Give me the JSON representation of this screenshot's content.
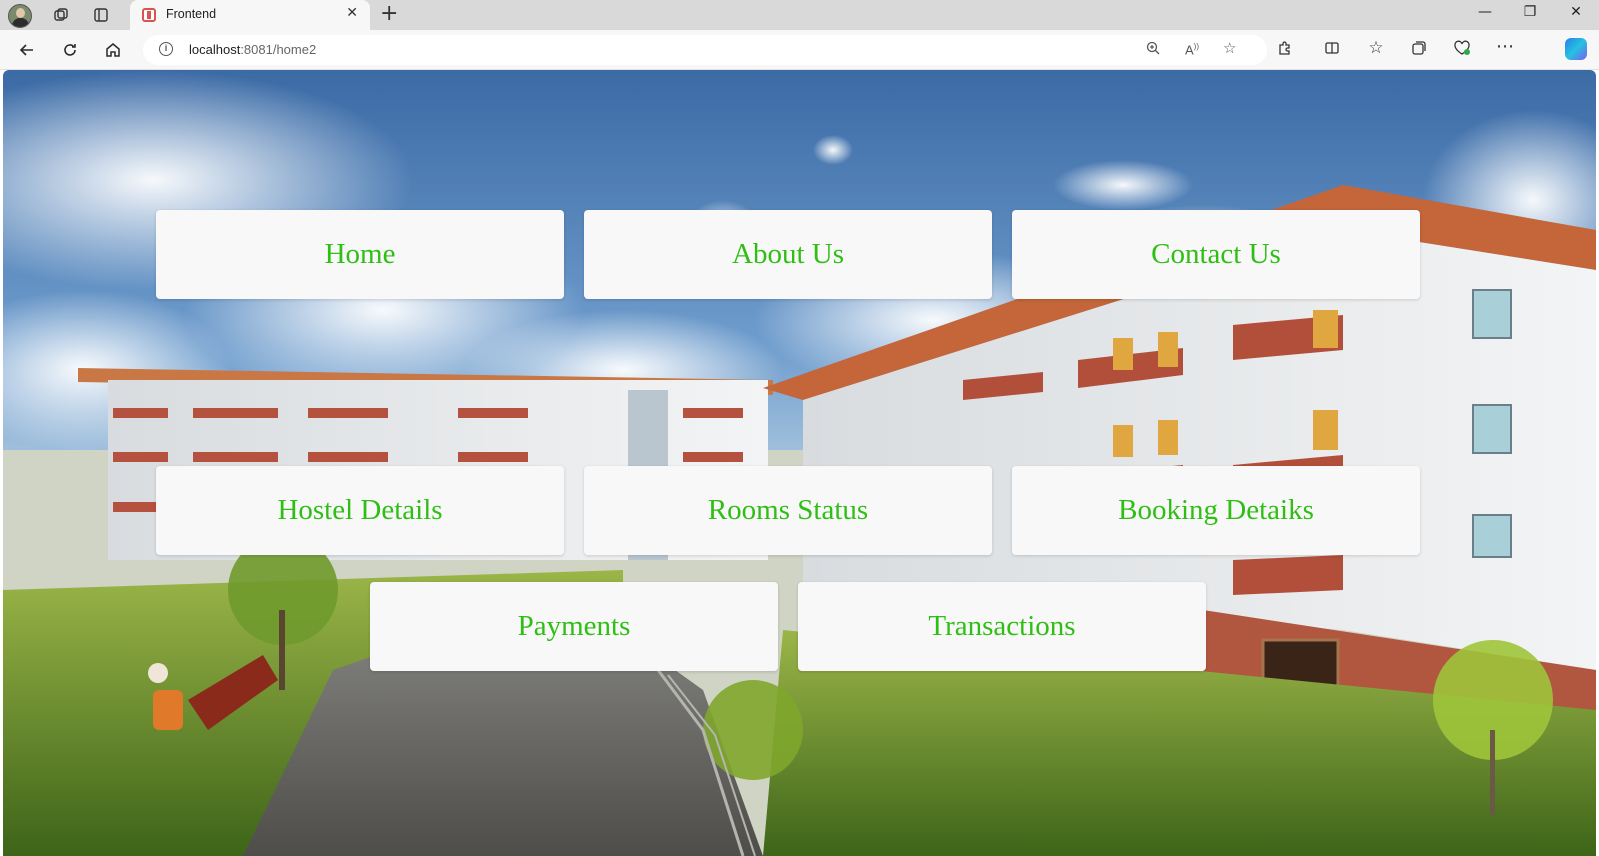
{
  "browser": {
    "tab_title": "Frontend",
    "url_host": "localhost",
    "url_rest": ":8081/home2"
  },
  "colors": {
    "accent_text": "#2fbf14",
    "card_bg": "#f8f8f8"
  },
  "nav_cards": {
    "home": "Home",
    "about": "About Us",
    "contact": "Contact Us",
    "hostel": "Hostel Details",
    "rooms": "Rooms Status",
    "booking": "Booking Detaiks",
    "payments": "Payments",
    "transactions": "Transactions"
  }
}
